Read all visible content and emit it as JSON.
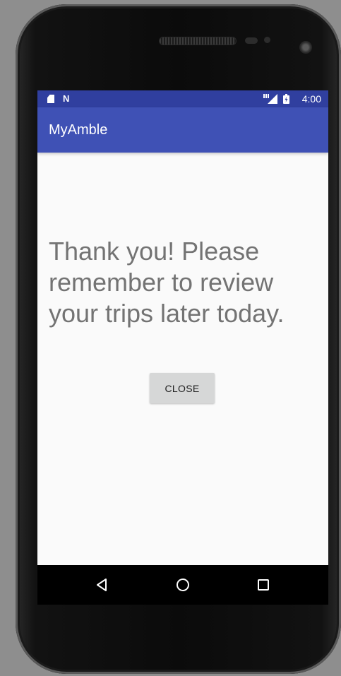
{
  "status_bar": {
    "time": "4:00",
    "icons": [
      "sd-card-icon",
      "n-notification-icon",
      "lte-signal-icon",
      "battery-icon"
    ],
    "n_glyph": "N",
    "background": "#303f9f"
  },
  "app_bar": {
    "title": "MyAmble",
    "background": "#3f51b5"
  },
  "content": {
    "message": "Thank you! Please remember to review your trips later today.",
    "close_label": "CLOSE"
  },
  "nav_bar": {
    "buttons": [
      "back-icon",
      "home-icon",
      "recents-icon"
    ]
  }
}
